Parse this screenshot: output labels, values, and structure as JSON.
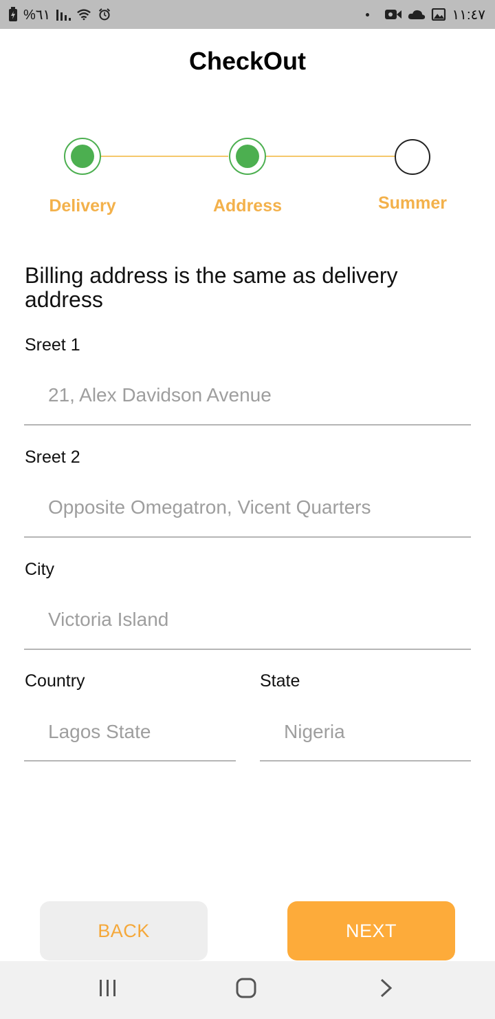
{
  "status_bar": {
    "battery_text": "%٦١",
    "time": "١١:٤٧"
  },
  "header": {
    "title": "CheckOut"
  },
  "stepper": {
    "steps": [
      {
        "label": "Delivery",
        "state": "done"
      },
      {
        "label": "Address",
        "state": "done"
      },
      {
        "label": "Summer",
        "state": "todo"
      }
    ],
    "colors": {
      "done": "#4caf50",
      "label": "#f3b14b",
      "line": "#f5c86b"
    }
  },
  "form": {
    "billing_text": "Billing address is the same as delivery address",
    "street1": {
      "label": "Sreet 1",
      "value": "21, Alex Davidson Avenue"
    },
    "street2": {
      "label": "Sreet 2",
      "value": "Opposite Omegatron, Vicent Quarters"
    },
    "city": {
      "label": "City",
      "value": "Victoria Island"
    },
    "country": {
      "label": "Country",
      "value": "Lagos State"
    },
    "state": {
      "label": "State",
      "value": "Nigeria"
    }
  },
  "buttons": {
    "back": "BACK",
    "next": "NEXT"
  },
  "nav": {
    "icons": [
      "recent-apps-icon",
      "home-icon",
      "back-chevron-icon"
    ]
  }
}
